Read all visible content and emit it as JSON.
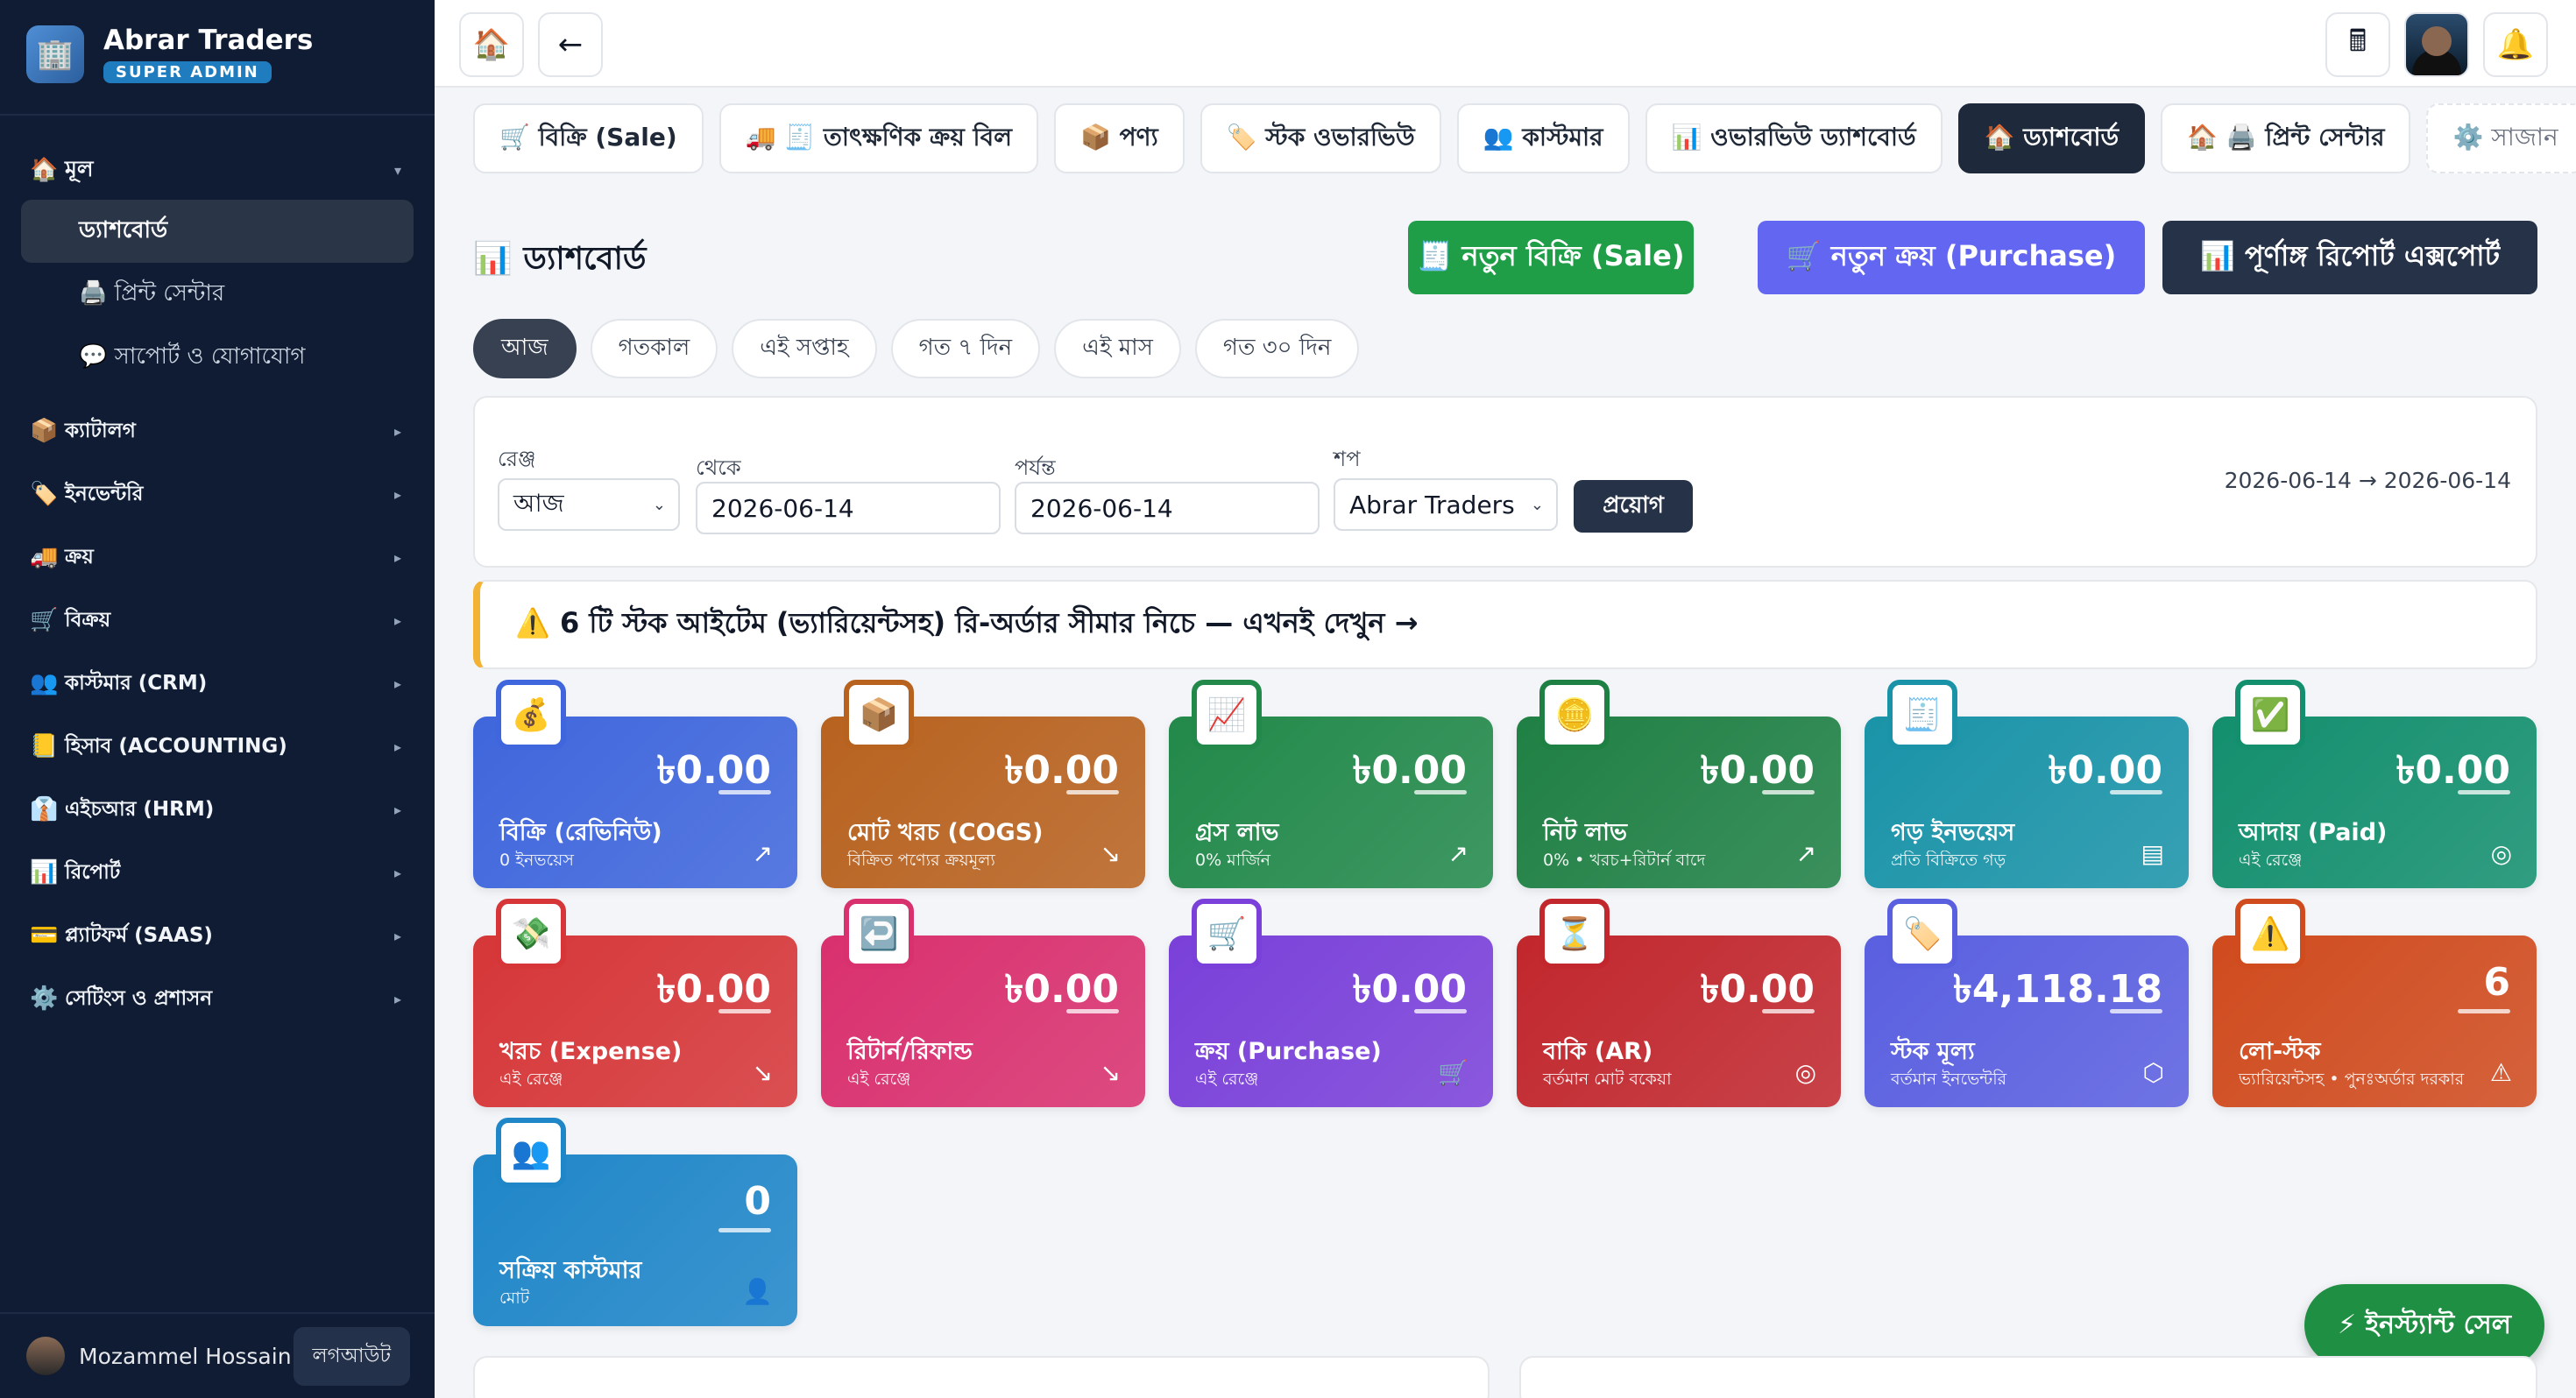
{
  "sidebar": {
    "brand_name": "Abrar Traders",
    "brand_role": "SUPER ADMIN",
    "logo_icon": "🏢",
    "main_group": {
      "icon": "🏠",
      "label": "মূল"
    },
    "main_items": [
      {
        "label": "ড্যাশবোর্ড",
        "active": true
      },
      {
        "label": "🖨️ প্রিন্ট সেন্টার",
        "active": false
      },
      {
        "label": "💬 সাপোর্ট ও যোগাযোগ",
        "active": false
      }
    ],
    "groups": [
      {
        "icon": "📦",
        "label": "ক্যাটালগ"
      },
      {
        "icon": "🏷️",
        "label": "ইনভেন্টরি"
      },
      {
        "icon": "🚚",
        "label": "ক্রয়"
      },
      {
        "icon": "🛒",
        "label": "বিক্রয়"
      },
      {
        "icon": "👥",
        "label": "কাস্টমার (CRM)"
      },
      {
        "icon": "📒",
        "label": "হিসাব (ACCOUNTING)"
      },
      {
        "icon": "👔",
        "label": "এইচআর (HRM)"
      },
      {
        "icon": "📊",
        "label": "রিপোর্ট"
      },
      {
        "icon": "💳",
        "label": "প্ল্যাটফর্ম (SAAS)"
      },
      {
        "icon": "⚙️",
        "label": "সেটিংস ও প্রশাসন"
      }
    ],
    "user_name": "Mozammel Hossain",
    "logout": "লগআউট"
  },
  "topbar": {
    "home_icon": "🏠",
    "back_icon": "←",
    "calc_icon": "🖩",
    "bell_icon": "🔔"
  },
  "tabs": [
    {
      "label": "🛒 বিক্রি (Sale)",
      "style": "normal"
    },
    {
      "label": "🚚 🧾 তাৎক্ষণিক ক্রয় বিল",
      "style": "normal"
    },
    {
      "label": "📦 পণ্য",
      "style": "normal"
    },
    {
      "label": "🏷️ স্টক ওভারভিউ",
      "style": "normal"
    },
    {
      "label": "👥 কাস্টমার",
      "style": "normal"
    },
    {
      "label": "📊 ওভারভিউ ড্যাশবোর্ড",
      "style": "normal"
    },
    {
      "label": "🏠 ড্যাশবোর্ড",
      "style": "active"
    },
    {
      "label": "🏠 🖨️ প্রিন্ট সেন্টার",
      "style": "normal"
    },
    {
      "label": "⚙️ সাজান",
      "style": "dashed"
    }
  ],
  "page": {
    "title": "📊 ড্যাশবোর্ড",
    "new_sale": "🧾 নতুন বিক্রি (Sale)",
    "new_purchase": "🛒 নতুন ক্রয় (Purchase)",
    "export_report": "📊 পূর্ণাঙ্গ রিপোর্ট এক্সপোর্ট"
  },
  "range_chips": [
    {
      "label": "আজ",
      "active": true
    },
    {
      "label": "গতকাল",
      "active": false
    },
    {
      "label": "এই সপ্তাহ",
      "active": false
    },
    {
      "label": "গত ৭ দিন",
      "active": false
    },
    {
      "label": "এই মাস",
      "active": false
    },
    {
      "label": "গত ৩০ দিন",
      "active": false
    }
  ],
  "filter": {
    "range_label": "রেঞ্জ",
    "range_value": "আজ",
    "from_label": "থেকে",
    "from_value": "2026-06-14",
    "to_label": "পর্যন্ত",
    "to_value": "2026-06-14",
    "shop_label": "শপ",
    "shop_value": "Abrar Traders",
    "apply": "প্রয়োগ",
    "range_text": "2026-06-14 → 2026-06-14"
  },
  "alert": {
    "text": "⚠️ 6 টি স্টক আইটেম (ভ্যারিয়েন্টসহ) রি-অর্ডার সীমার নিচে — এখনই দেখুন →",
    "border_color": "#f2b233"
  },
  "cards": [
    {
      "icon": "💰",
      "value": "৳0.00",
      "title": "বিক্রি (রেভিনিউ)",
      "sub": "0 ইনভয়েস",
      "trend_icon": "↗",
      "color": "#3f66dc"
    },
    {
      "icon": "📦",
      "value": "৳0.00",
      "title": "মোট খরচ (COGS)",
      "sub": "বিক্রিত পণ্যের ক্রয়মূল্য",
      "trend_icon": "↘",
      "color": "#b8621f"
    },
    {
      "icon": "📈",
      "value": "৳0.00",
      "title": "গ্রস লাভ",
      "sub": "0% মার্জিন",
      "trend_icon": "↗",
      "color": "#22894a"
    },
    {
      "icon": "🪙",
      "value": "৳0.00",
      "title": "নিট লাভ",
      "sub": "0% • খরচ+রিটার্ন বাদে",
      "trend_icon": "↗",
      "color": "#1f8044"
    },
    {
      "icon": "🧾",
      "value": "৳0.00",
      "title": "গড় ইনভয়েস",
      "sub": "প্রতি বিক্রিতে গড়",
      "trend_icon": "▤",
      "color": "#1a93a8"
    },
    {
      "icon": "✅",
      "value": "৳0.00",
      "title": "আদায় (Paid)",
      "sub": "এই রেঞ্জে",
      "trend_icon": "◎",
      "color": "#138f6e"
    },
    {
      "icon": "💸",
      "value": "৳0.00",
      "title": "খরচ (Expense)",
      "sub": "এই রেঞ্জে",
      "trend_icon": "↘",
      "color": "#d63638"
    },
    {
      "icon": "↩️",
      "value": "৳0.00",
      "title": "রিটার্ন/রিফান্ড",
      "sub": "এই রেঞ্জে",
      "trend_icon": "↘",
      "color": "#d9306e"
    },
    {
      "icon": "🛒",
      "value": "৳0.00",
      "title": "ক্রয় (Purchase)",
      "sub": "এই রেঞ্জে",
      "trend_icon": "🛒",
      "color": "#7a40d9"
    },
    {
      "icon": "⏳",
      "value": "৳0.00",
      "title": "বাকি (AR)",
      "sub": "বর্তমান মোট বকেয়া",
      "trend_icon": "◎",
      "color": "#c1272d"
    },
    {
      "icon": "🏷️",
      "value": "৳4,118.18",
      "title": "স্টক মূল্য",
      "sub": "বর্তমান ইনভেন্টরি",
      "trend_icon": "⬡",
      "color": "#5a5fe0"
    },
    {
      "icon": "⚠️",
      "value": "6",
      "title": "লো-স্টক",
      "sub": "ভ্যারিয়েন্টসহ • পুনঃঅর্ডার দরকার",
      "trend_icon": "⚠",
      "color": "#d04b1e"
    },
    {
      "icon": "👥",
      "value": "0",
      "title": "সক্রিয় কাস্টমার",
      "sub": "মোট",
      "trend_icon": "👤",
      "color": "#1f86c8"
    }
  ],
  "fab": "⚡ ইনস্ট্যান্ট সেল"
}
